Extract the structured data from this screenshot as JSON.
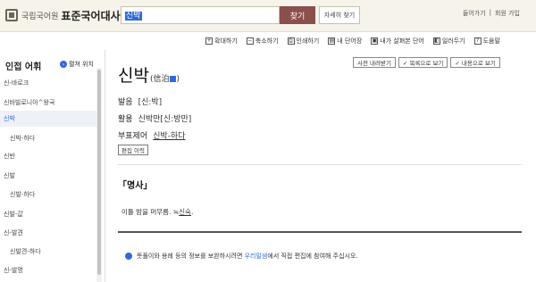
{
  "header": {
    "logo_small": "국립국어원",
    "logo_big": "표준국어대사전",
    "search_value": "신박",
    "search_button": "찾기",
    "detail_button": "자세히 찾기",
    "login": "들어가기",
    "signup": "회원 가입",
    "sep": "|"
  },
  "toolbar": {
    "items": [
      {
        "icon": "+",
        "label": "확대하기"
      },
      {
        "icon": "−",
        "label": "축소하기"
      },
      {
        "icon": "⎙",
        "label": "인쇄하기"
      },
      {
        "icon": "▤",
        "label": "내 단어장"
      },
      {
        "icon": "▣",
        "label": "내가 살펴본 단어"
      },
      {
        "icon": "◧",
        "label": "일러두기"
      },
      {
        "icon": "?",
        "label": "도움말"
      }
    ]
  },
  "sidebar": {
    "title": "인접 어휘",
    "jump_label": "펼쳐 위치",
    "jump_icon": "›",
    "items": [
      {
        "label": "신-바로크"
      },
      {
        "label": "신바빌로니아^왕국"
      },
      {
        "label": "신박",
        "active": true
      },
      {
        "label": "신박-하다",
        "sub": true
      },
      {
        "label": "신반"
      },
      {
        "label": "신발"
      },
      {
        "label": "신발-하다",
        "sub": true
      },
      {
        "label": "신발-값"
      },
      {
        "label": "신-발견"
      },
      {
        "label": "신발견-하다",
        "sub": true
      },
      {
        "label": "신-발명"
      }
    ]
  },
  "entry": {
    "headword": "신박",
    "hanja": "(信泊",
    "hanja_close": ")",
    "buttons": {
      "download": "사전 내려받기",
      "list_view": "✓ 목록으로 보기",
      "content_view": "✓ 내용으로 보기"
    },
    "pronunciation_label": "발음",
    "pronunciation_value": "[신:박]",
    "conjugation_label": "활용",
    "conjugation_value": "신박만[신:방만]",
    "derivative_label": "부표제어",
    "derivative_value": "신박-하다",
    "edit_history": "편집 이력",
    "pos": "「명사」",
    "definition_text": "이틀 밤을 머무름. ≒",
    "definition_link": "신숙",
    "definition_end": ".",
    "notice_pre": "뜻풀이와 용례 등의 정보를 보완하시려면 ",
    "notice_link": "우리말샘",
    "notice_post": "에서 직접 편집에 참여해 주십시오."
  }
}
